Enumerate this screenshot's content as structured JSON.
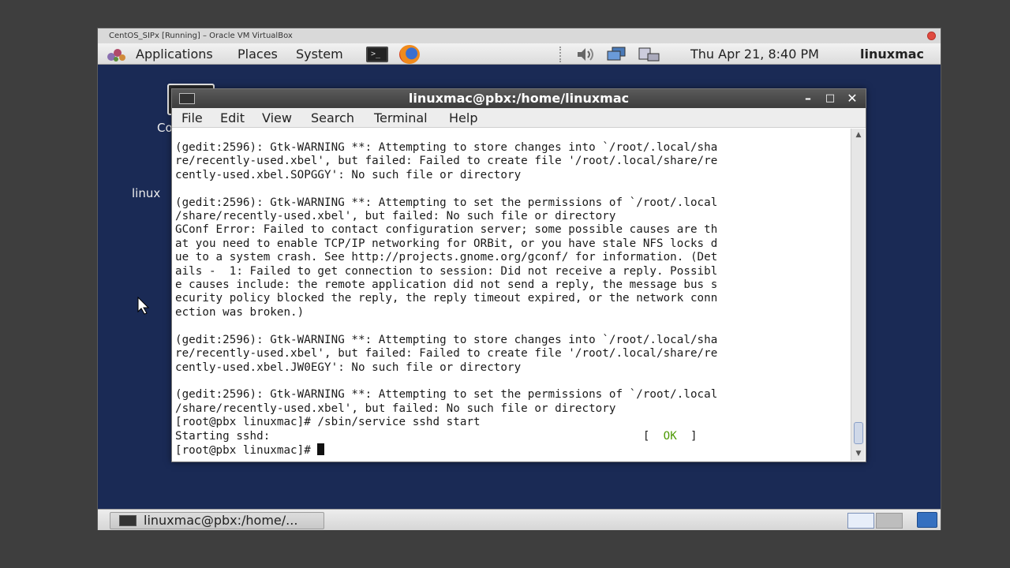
{
  "vbox": {
    "title": "CentOS_SIPx [Running] – Oracle VM VirtualBox"
  },
  "panel": {
    "applications": "Applications",
    "places": "Places",
    "system": "System",
    "clock": "Thu Apr 21,  8:40 PM",
    "user": "linuxmac"
  },
  "desktop": {
    "computer_label": "Co",
    "home_label": "linux"
  },
  "terminal": {
    "title": "linuxmac@pbx:/home/linuxmac",
    "menu": [
      "File",
      "Edit",
      "View",
      "Search",
      "Terminal",
      "Help"
    ],
    "lines": [
      "(gedit:2596): Gtk-WARNING **: Attempting to store changes into `/root/.local/sha",
      "re/recently-used.xbel', but failed: Failed to create file '/root/.local/share/re",
      "cently-used.xbel.SOPGGY': No such file or directory",
      "",
      "(gedit:2596): Gtk-WARNING **: Attempting to set the permissions of `/root/.local",
      "/share/recently-used.xbel', but failed: No such file or directory",
      "GConf Error: Failed to contact configuration server; some possible causes are th",
      "at you need to enable TCP/IP networking for ORBit, or you have stale NFS locks d",
      "ue to a system crash. See http://projects.gnome.org/gconf/ for information. (Det",
      "ails -  1: Failed to get connection to session: Did not receive a reply. Possibl",
      "e causes include: the remote application did not send a reply, the message bus s",
      "ecurity policy blocked the reply, the reply timeout expired, or the network conn",
      "ection was broken.)",
      "",
      "(gedit:2596): Gtk-WARNING **: Attempting to store changes into `/root/.local/sha",
      "re/recently-used.xbel', but failed: Failed to create file '/root/.local/share/re",
      "cently-used.xbel.JW0EGY': No such file or directory",
      "",
      "(gedit:2596): Gtk-WARNING **: Attempting to set the permissions of `/root/.local",
      "/share/recently-used.xbel', but failed: No such file or directory",
      "[root@pbx linuxmac]# /sbin/service sshd start"
    ],
    "starting_text": "Starting sshd:",
    "ok_open": "[  ",
    "ok_text": "OK",
    "ok_close": "  ]",
    "prompt": "[root@pbx linuxmac]# "
  },
  "taskbar": {
    "task_label": "linuxmac@pbx:/home/..."
  }
}
